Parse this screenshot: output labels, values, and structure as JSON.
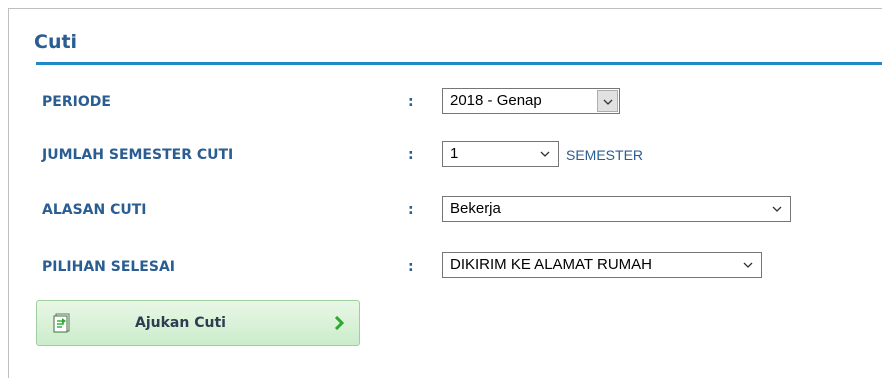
{
  "form": {
    "title": "Cuti",
    "fields": [
      {
        "label": "PERIODE",
        "colon": ":",
        "value": "2018 - Genap"
      },
      {
        "label": "JUMLAH SEMESTER CUTI",
        "colon": ":",
        "value": "1",
        "unit": "SEMESTER"
      },
      {
        "label": "ALASAN CUTI",
        "colon": ":",
        "value": "Bekerja"
      },
      {
        "label": "PILIHAN SELESAI",
        "colon": ":",
        "value": "DIKIRIM KE ALAMAT RUMAH"
      }
    ],
    "submit_label": "Ajukan Cuti"
  },
  "colors": {
    "accent": "#2a5d91",
    "rule": "#1f88c9",
    "button_bg": "#cbeccb",
    "button_arrow": "#2ea82e"
  },
  "icons": {
    "submit_left": "document-icon",
    "submit_right": "chevron-right-icon",
    "select_arrow": "chevron-down-icon"
  }
}
